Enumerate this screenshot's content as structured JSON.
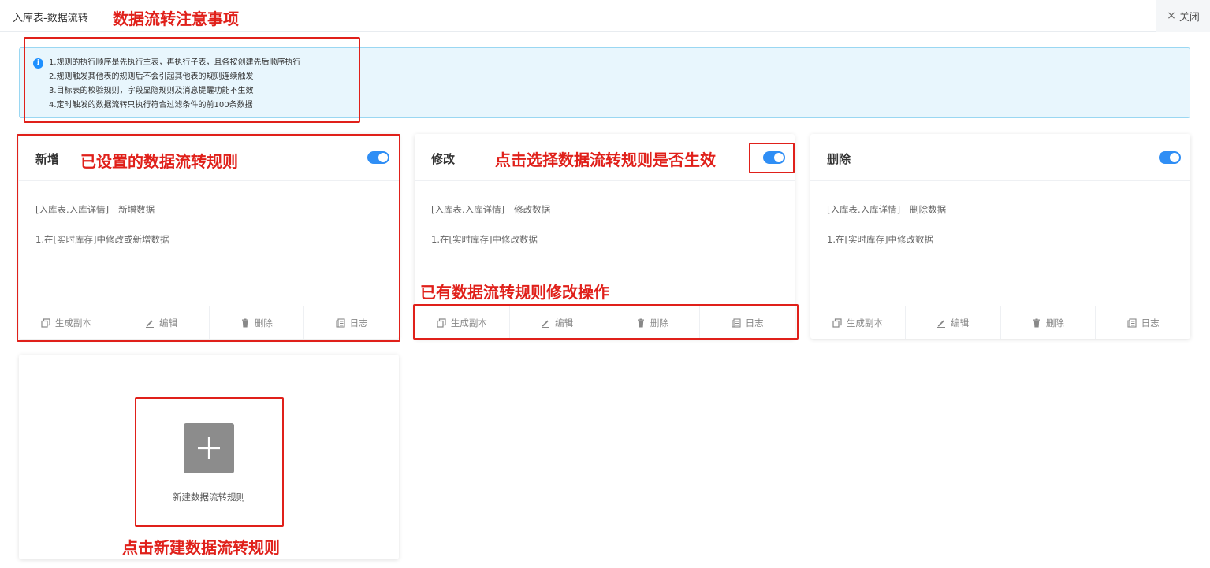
{
  "header": {
    "title": "入库表-数据流转",
    "close_label": "关闭"
  },
  "info": {
    "lines": [
      "1.规则的执行顺序是先执行主表，再执行子表，且各按创建先后顺序执行",
      "2.规则触发其他表的规则后不会引起其他表的规则连续触发",
      "3.目标表的校验规则，字段显隐规则及消息提醒功能不生效",
      "4.定时触发的数据流转只执行符合过滤条件的前100条数据"
    ]
  },
  "cards": [
    {
      "title": "新增",
      "enabled": true,
      "target": "[入库表.入库详情]",
      "action": "新增数据",
      "condition": "1.在[实时库存]中修改或新增数据",
      "buttons": [
        "生成副本",
        "编辑",
        "删除",
        "日志"
      ]
    },
    {
      "title": "修改",
      "enabled": true,
      "target": "[入库表.入库详情]",
      "action": "修改数据",
      "condition": "1.在[实时库存]中修改数据",
      "buttons": [
        "生成副本",
        "编辑",
        "删除",
        "日志"
      ]
    },
    {
      "title": "删除",
      "enabled": true,
      "target": "[入库表.入库详情]",
      "action": "删除数据",
      "condition": "1.在[实时库存]中修改数据",
      "buttons": [
        "生成副本",
        "编辑",
        "删除",
        "日志"
      ]
    }
  ],
  "new_rule": {
    "label": "新建数据流转规则"
  },
  "annotations": {
    "notes_title": "数据流转注意事项",
    "existing_rules": "已设置的数据流转规则",
    "toggle_hint": "点击选择数据流转规则是否生效",
    "edit_ops": "已有数据流转规则修改操作",
    "new_hint": "点击新建数据流转规则"
  },
  "colors": {
    "accent": "#2f8ef5",
    "annotation": "#e0201a",
    "info_bg": "#e8f6fd"
  }
}
